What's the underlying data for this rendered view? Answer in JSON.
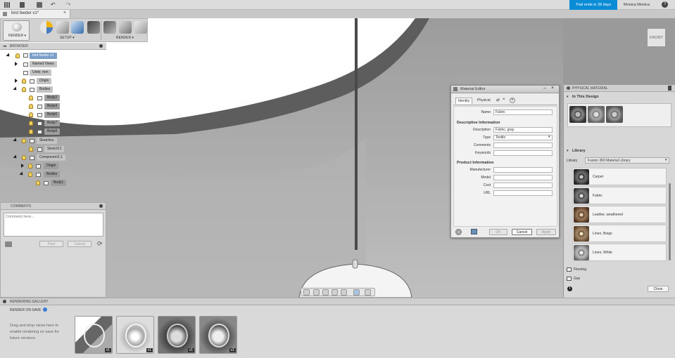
{
  "app": {
    "trial_text": "Trial ends in 28 days",
    "user_name": "Monica Monica",
    "help_label": "?",
    "doc_tab_title": "bird feeder v1*",
    "doc_tab_close": "×"
  },
  "toolbar": {
    "render_workspace_label": "RENDER ▾",
    "setup_label": "SETUP ▾",
    "render_label": "RENDER ▾"
  },
  "viewcube": {
    "label": "FRONT"
  },
  "browser": {
    "title": "BROWSER",
    "nodes": [
      {
        "label": "bird feeder v1"
      },
      {
        "label": "Named Views"
      },
      {
        "label": "Units: mm"
      },
      {
        "label": "Origin"
      },
      {
        "label": "Bodies"
      },
      {
        "label": "Body2"
      },
      {
        "label": "Body4"
      },
      {
        "label": "Body6"
      },
      {
        "label": "Body7"
      },
      {
        "label": "Body8"
      },
      {
        "label": "Sketches"
      },
      {
        "label": "Sketch11"
      },
      {
        "label": "Component1:1"
      },
      {
        "label": "Origin"
      },
      {
        "label": "Bodies"
      },
      {
        "label": "Body1"
      }
    ]
  },
  "comments": {
    "title": "COMMENTS",
    "placeholder": "Comment here...",
    "post_label": "Post",
    "cancel_label": "Cancel"
  },
  "material_editor": {
    "title": "Material Editor",
    "tabs": {
      "identity": "Identity",
      "physical": "Physical"
    },
    "name_label": "Name",
    "name_value": "Fabric",
    "section_descriptive": "Descriptive Information",
    "description_label": "Description",
    "description_value": "Fabric, gray",
    "type_label": "Type",
    "type_value": "Textile",
    "comments_label": "Comments",
    "keywords_label": "Keywords",
    "section_product": "Product Information",
    "manufacturer_label": "Manufacturer",
    "model_label": "Model",
    "cost_label": "Cost",
    "url_label": "URL",
    "ok_label": "OK",
    "cancel_label": "Cancel",
    "apply_label": "Apply"
  },
  "physical_material": {
    "title": "PHYSICAL MATERIAL",
    "in_this_design_label": "In This Design",
    "library_section_label": "Library",
    "library_field_label": "Library",
    "library_value": "Fusion 360 Material Library",
    "items": [
      {
        "label": "Carpet",
        "color": "#6f6f6f"
      },
      {
        "label": "Fabric",
        "color": "#7a7a7a"
      },
      {
        "label": "Leather, weathered",
        "color": "#9b7a5a"
      },
      {
        "label": "Linen, Beige",
        "color": "#a48a6a"
      },
      {
        "label": "Linen, White",
        "color": "#bdbdbd"
      }
    ],
    "folders": [
      {
        "label": "Flooring"
      },
      {
        "label": "Gas"
      }
    ],
    "close_label": "Close",
    "info_label": "i"
  },
  "gallery": {
    "title": "RENDERING GALLERY",
    "render_on_save_label": "RENDER ON SAVE",
    "hint": "Drag and drop views here to enable rendering on save for future versions",
    "thumbnails": [
      {
        "version": "v1"
      },
      {
        "version": "v1"
      },
      {
        "version": "v1"
      },
      {
        "version": "v1"
      }
    ]
  }
}
